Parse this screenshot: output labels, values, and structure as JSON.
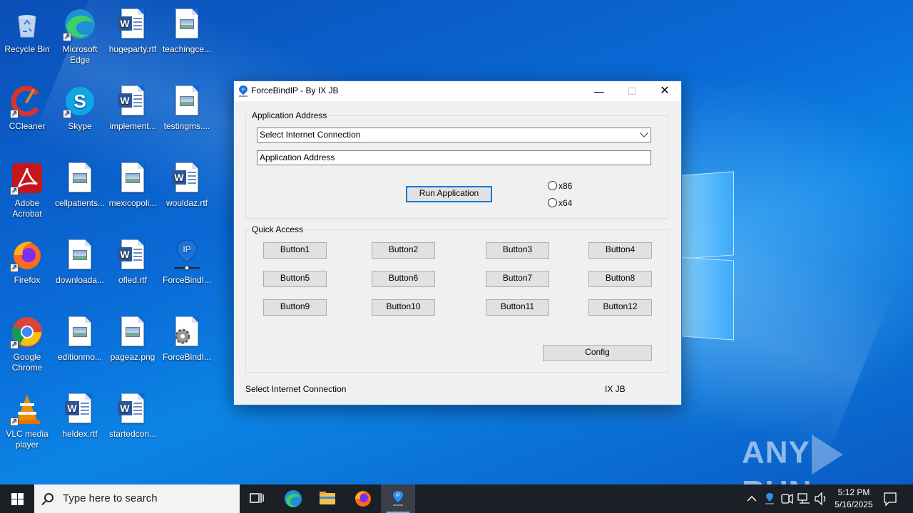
{
  "desktop": {
    "icons": [
      {
        "label": "Recycle Bin",
        "kind": "recycle"
      },
      {
        "label": "Microsoft Edge",
        "kind": "edge"
      },
      {
        "label": "hugeparty.rtf",
        "kind": "word"
      },
      {
        "label": "teachingce...",
        "kind": "image"
      },
      {
        "label": "CCleaner",
        "kind": "ccleaner"
      },
      {
        "label": "Skype",
        "kind": "skype"
      },
      {
        "label": "implement...",
        "kind": "word"
      },
      {
        "label": "testingms....",
        "kind": "image"
      },
      {
        "label": "Adobe Acrobat",
        "kind": "acrobat"
      },
      {
        "label": "cellpatients...",
        "kind": "image"
      },
      {
        "label": "mexicopoli...",
        "kind": "image"
      },
      {
        "label": "wouldaz.rtf",
        "kind": "word"
      },
      {
        "label": "Firefox",
        "kind": "firefox"
      },
      {
        "label": "downloada...",
        "kind": "image"
      },
      {
        "label": "ofled.rtf",
        "kind": "word"
      },
      {
        "label": "ForceBindI...",
        "kind": "forcebind"
      },
      {
        "label": "Google Chrome",
        "kind": "chrome"
      },
      {
        "label": "editionmo...",
        "kind": "image"
      },
      {
        "label": "pageaz.png",
        "kind": "image"
      },
      {
        "label": "ForceBindI...",
        "kind": "settingsdoc"
      },
      {
        "label": "VLC media player",
        "kind": "vlc"
      },
      {
        "label": "heldex.rtf",
        "kind": "word"
      },
      {
        "label": "startedcon...",
        "kind": "word"
      }
    ]
  },
  "window": {
    "title": "ForceBindIP - By IX JB",
    "app_group_label": "Application Address",
    "connection_select_value": "Select Internet Connection",
    "address_input_value": "Application Address",
    "run_button_label": "Run Application",
    "radio_x86": "x86",
    "radio_x64": "x64",
    "quick_group_label": "Quick Access",
    "quick_buttons": [
      "Button1",
      "Button2",
      "Button3",
      "Button4",
      "Button5",
      "Button6",
      "Button7",
      "Button8",
      "Button9",
      "Button10",
      "Button11",
      "Button12"
    ],
    "config_button_label": "Config",
    "status_left": "Select Internet Connection",
    "status_right": "IX JB",
    "controls": {
      "minimize": "—",
      "maximize": "☐",
      "close": "✕"
    }
  },
  "watermark": {
    "left": "ANY",
    "right": "RUN"
  },
  "taskbar": {
    "search_placeholder": "Type here to search",
    "pinned": [
      "task-view",
      "edge",
      "file-explorer",
      "firefox",
      "forcebindip"
    ],
    "active": "forcebindip",
    "time": "5:12 PM",
    "date": "5/16/2025"
  },
  "colors": {
    "accent": "#0078d7",
    "taskbar": "#1b1f26",
    "window_bg": "#f0f0f0"
  }
}
